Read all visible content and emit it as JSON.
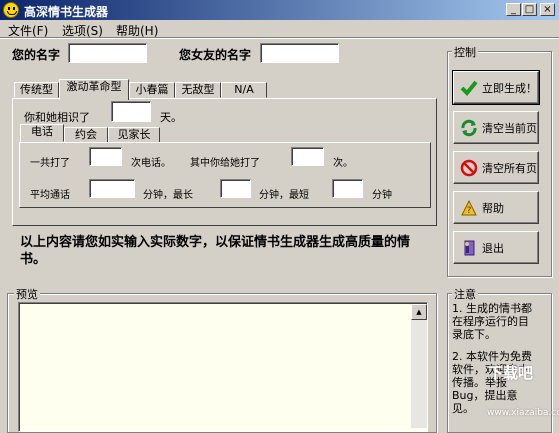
{
  "window": {
    "title": "高深情书生成器",
    "min_glyph": "_",
    "max_glyph": "□",
    "close_glyph": "×"
  },
  "menu": [
    "文件(F)",
    "选项(S)",
    "帮助(H)"
  ],
  "names": {
    "your_name_label": "您的名字",
    "your_name_value": "",
    "gf_name_label": "您女友的名字",
    "gf_name_value": ""
  },
  "tabs": [
    "传统型",
    "激动革命型",
    "小春篇",
    "无敌型",
    "N/A"
  ],
  "active_tab": 1,
  "known_days": {
    "prefix": "你和她相识了",
    "value": "",
    "suffix": "天。"
  },
  "subtabs": [
    "电话",
    "约会",
    "见家长"
  ],
  "phone": {
    "total_prefix": "一共打了",
    "total_value": "",
    "total_suffix": "次电话。",
    "yours_prefix": "其中你给她打了",
    "yours_value": "",
    "yours_suffix": "次。",
    "avg_prefix": "平均通话",
    "avg_value": "",
    "avg_unit": "分钟，最长",
    "max_value": "",
    "max_unit": "分钟，最短",
    "min_value": "",
    "min_unit": "分钟"
  },
  "warning": "以上内容请您如实输入实际数字，以保证情书生成器生成高质量的情书。",
  "control": {
    "title": "控制",
    "buttons": [
      {
        "label": "立即生成！",
        "icon": "checkmark-icon"
      },
      {
        "label": "清空当前页",
        "icon": "refresh-icon"
      },
      {
        "label": "清空所有页",
        "icon": "no-entry-icon"
      },
      {
        "label": "帮助",
        "icon": "help-icon"
      },
      {
        "label": "退出",
        "icon": "exit-door-icon"
      }
    ]
  },
  "preview": {
    "title": "预览",
    "content": ""
  },
  "notes": {
    "title": "注意",
    "items": [
      "1. 生成的情书都在程序运行的目录底下。",
      "2. 本软件为免费软件，欢迎自由传播。举报Bug，提出意见。"
    ]
  },
  "watermark": {
    "brand": "下载吧",
    "url": "www.xiazaiba.com"
  },
  "colors": {
    "title_start": "#0a246a",
    "title_end": "#a6caf0",
    "face": "#d4d0c8",
    "preview_bg": "#fffff0"
  }
}
